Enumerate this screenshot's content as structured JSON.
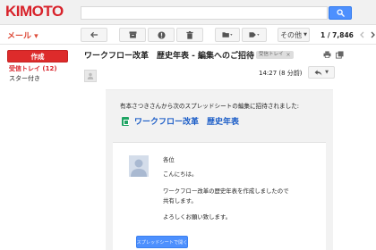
{
  "header": {
    "logo": "KIMOTO",
    "search_value": ""
  },
  "toolbar": {
    "mail_label": "メール ▾",
    "more_label": "その他",
    "page_count": "1 / 7,846"
  },
  "sidebar": {
    "compose_label": "作成",
    "items": [
      {
        "label": "受信トレイ (12)"
      },
      {
        "label": "スター付き"
      }
    ]
  },
  "message": {
    "subject": "ワークフロー改革　歴史年表 - 編集へのご招待",
    "label_tag": "受信トレイ",
    "timestamp": "14:27 (8 分前)"
  },
  "email": {
    "invite_line": "有本さつきさんから次のスプレッドシートの編集に招待されました:",
    "sheet_title": "ワークフロー改革　歴史年表",
    "body_lines": [
      "各位",
      "こんにちは。",
      "ワークフロー改革の歴史年表を作成しましたので",
      "共有します。",
      "よろしくお願い致します。"
    ],
    "open_button": "スプレッドシートで開く"
  },
  "colors": {
    "brand_red": "#d8222a",
    "compose_red": "#dd2b2b",
    "link_blue": "#1a5cc7",
    "button_blue": "#4d90fe",
    "sheets_green": "#1fa463"
  }
}
